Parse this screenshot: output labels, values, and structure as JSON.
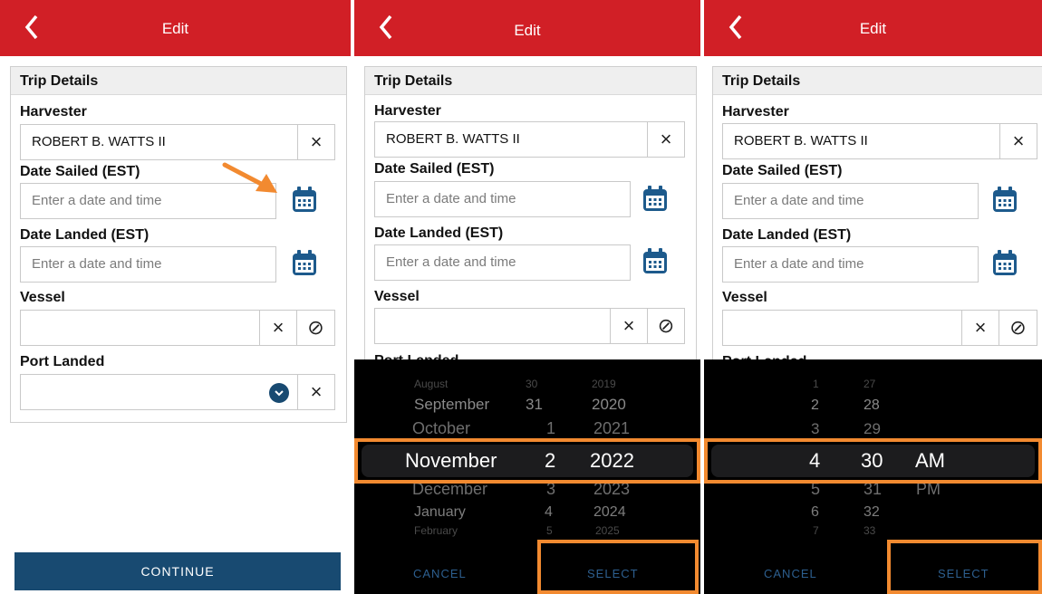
{
  "header": {
    "title": "Edit"
  },
  "form": {
    "section_title": "Trip Details",
    "harvester_label": "Harvester",
    "harvester_value": "ROBERT B. WATTS II",
    "date_sailed_label": "Date Sailed (EST)",
    "date_sailed_placeholder": "Enter a date and time",
    "date_landed_label": "Date Landed (EST)",
    "date_landed_placeholder": "Enter a date and time",
    "vessel_label": "Vessel",
    "port_landed_label": "Port Landed",
    "clear_glyph": "×",
    "none_glyph": "⊘"
  },
  "continue_label": "CONTINUE",
  "date_picker": {
    "months": [
      "August",
      "September",
      "October",
      "November",
      "December",
      "January",
      "February"
    ],
    "days": [
      "30",
      "31",
      "1",
      "2",
      "3",
      "4",
      "5"
    ],
    "years": [
      "2019",
      "2020",
      "2021",
      "2022",
      "2023",
      "2024",
      "2025"
    ],
    "cancel_label": "CANCEL",
    "select_label": "SELECT"
  },
  "time_picker": {
    "hours": [
      "1",
      "2",
      "3",
      "4",
      "5",
      "6",
      "7"
    ],
    "minutes": [
      "27",
      "28",
      "29",
      "30",
      "31",
      "32",
      "33"
    ],
    "ampm_selected": "AM",
    "ampm_other": "PM",
    "cancel_label": "CANCEL",
    "select_label": "SELECT"
  },
  "colors": {
    "header": "#d11f26",
    "accent": "#184a71",
    "highlight": "#f28a30",
    "icon": "#1d5a8c"
  }
}
